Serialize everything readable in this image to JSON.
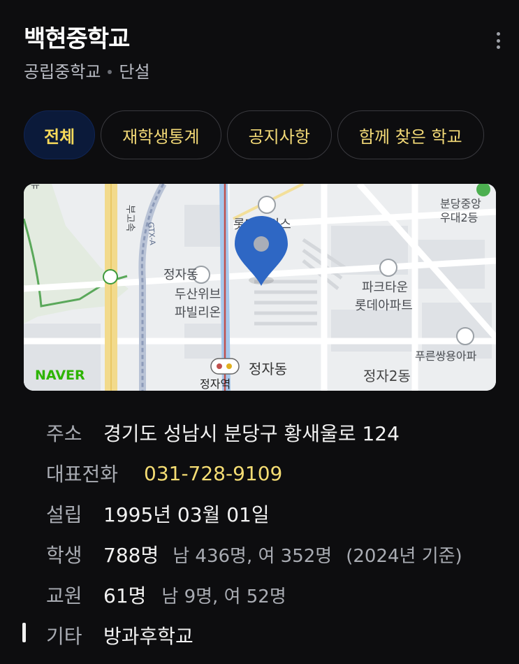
{
  "school": {
    "name": "백현중학교",
    "type": "공립중학교",
    "status": "단설"
  },
  "tabs": [
    {
      "label": "전체",
      "active": true
    },
    {
      "label": "재학생통계",
      "active": false
    },
    {
      "label": "공지사항",
      "active": false
    },
    {
      "label": "함께 찾은 학교",
      "active": false
    }
  ],
  "map": {
    "provider": "NAVER",
    "labels": {
      "hwy": "부고속",
      "gtx": "GTX-A",
      "park": "퓨",
      "jeongja_dong_top": "정자동",
      "doosan": "두산위브",
      "pavilion": "파빌리온",
      "lotte_place": "롯데팰리스",
      "parktown": "파크타운",
      "lotte_apt": "롯데아파트",
      "bundang": "분당중앙",
      "woodae": "우대2등",
      "jeongja_station": "정자역",
      "jeongja_dong": "정자동",
      "jeongja2": "정자2동",
      "pureun": "푸른쌍용아파"
    }
  },
  "info": {
    "address_label": "주소",
    "address": "경기도 성남시 분당구 황새울로 124",
    "phone_label": "대표전화",
    "phone": "031-728-9109",
    "founded_label": "설립",
    "founded": "1995년 03월 01일",
    "students_label": "학생",
    "students_total": "788명",
    "students_detail": "남 436명, 여 352명",
    "students_basis": "(2024년 기준)",
    "teachers_label": "교원",
    "teachers_total": "61명",
    "teachers_detail": "남 9명, 여 52명",
    "etc_label": "기타",
    "etc": "방과후학교"
  },
  "colors": {
    "background": "#0d0d0f",
    "accent_yellow": "#f4dc73",
    "active_tab_bg": "#0b1a3a",
    "pin_blue": "#2e67c4",
    "naver_green": "#03c75a"
  }
}
